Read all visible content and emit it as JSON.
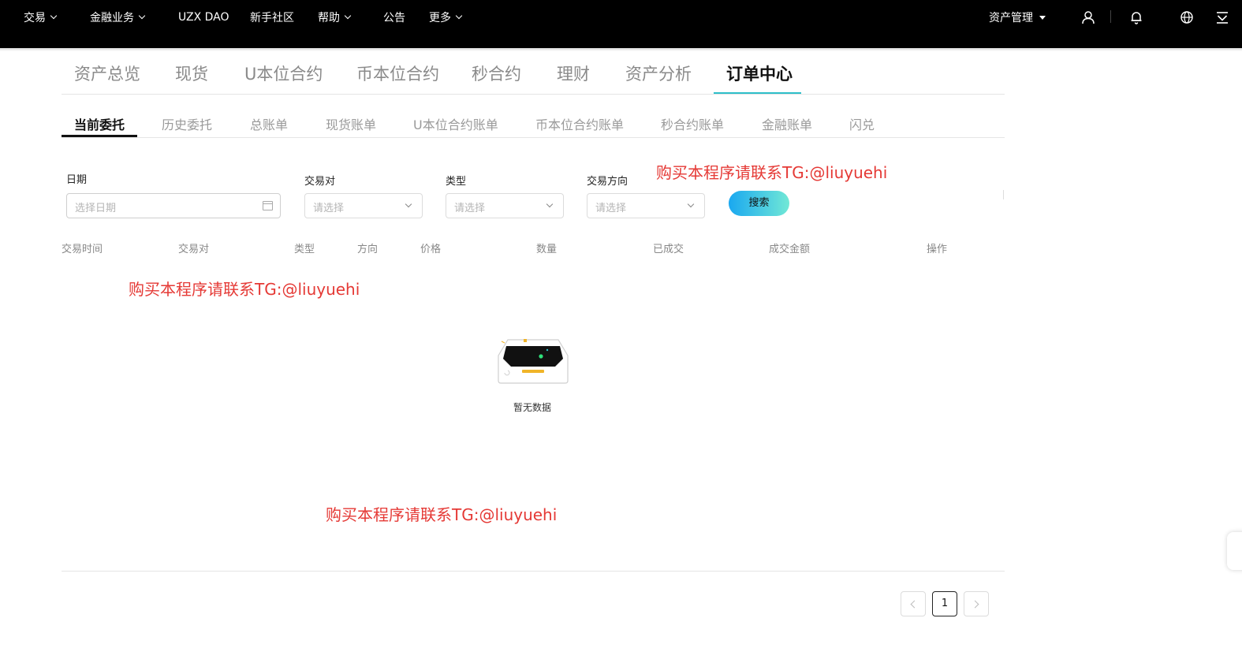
{
  "topnav": {
    "items": [
      "交易",
      "金融业务",
      "UZX DAO",
      "新手社区",
      "帮助",
      "公告",
      "更多"
    ],
    "asset_management": "资产管理"
  },
  "main_tabs": {
    "items": [
      "资产总览",
      "现货",
      "U本位合约",
      "币本位合约",
      "秒合约",
      "理财",
      "资产分析",
      "订单中心"
    ],
    "active": "订单中心"
  },
  "sub_tabs": {
    "items": [
      "当前委托",
      "历史委托",
      "总账单",
      "现货账单",
      "U本位合约账单",
      "币本位合约账单",
      "秒合约账单",
      "金融账单",
      "闪兑"
    ],
    "active": "当前委托"
  },
  "filters": {
    "date_label": "日期",
    "date_placeholder": "选择日期",
    "pair_label": "交易对",
    "pair_placeholder": "请选择",
    "type_label": "类型",
    "type_placeholder": "请选择",
    "direction_label": "交易方向",
    "direction_placeholder": "请选择",
    "search_button": "搜索"
  },
  "table": {
    "columns": [
      "交易时间",
      "交易对",
      "类型",
      "方向",
      "价格",
      "数量",
      "已成交",
      "成交金额",
      "操作"
    ],
    "empty_text": "暂无数据"
  },
  "watermarks": [
    "购买本程序请联系TG:@liuyuehi",
    "购买本程序请联系TG:@liuyuehi",
    "购买本程序请联系TG:@liuyuehi"
  ],
  "pagination": {
    "current_page": "1"
  },
  "colors": {
    "accent": "#2dbfc9",
    "watermark": "#e53935",
    "topbar": "#000000"
  },
  "icons": [
    "chevron-down-icon",
    "user-icon",
    "bell-icon",
    "globe-icon",
    "download-icon",
    "calendar-icon",
    "empty-box-icon"
  ]
}
